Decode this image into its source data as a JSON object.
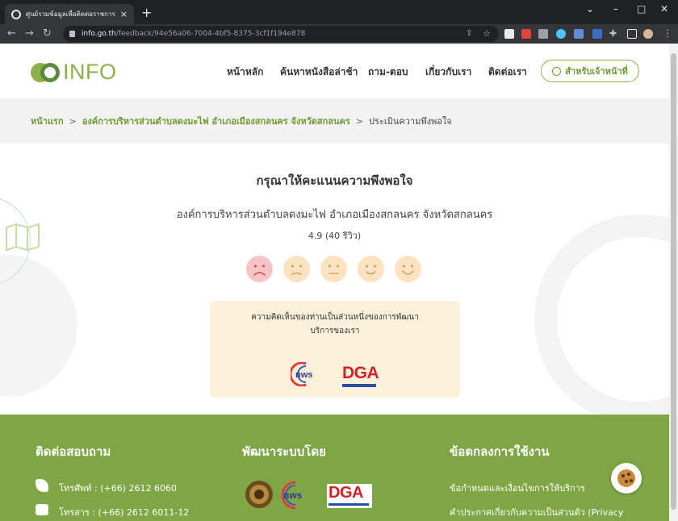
{
  "browser": {
    "tab_title": "ศูนย์รวมข้อมูลเพื่อติดต่อราชการ",
    "tab_close": "×",
    "new_tab": "+",
    "url_host": "info.go.th",
    "url_path": "/feedback/94e56a06-7004-4bf5-8375-3cf1f194e878"
  },
  "header": {
    "logo_text": "INFO",
    "nav": [
      "หน้าหลัก",
      "ค้นหาหนังสือล่าช้า",
      "ถาม-ตอบ",
      "เกี่ยวกับเรา",
      "ติดต่อเรา"
    ],
    "staff_button": "สำหรับเจ้าหน้าที่"
  },
  "breadcrumb": {
    "home": "หน้าแรก",
    "sep": ">",
    "org": "องค์การบริหารส่วนตำบลดงมะไฟ อำเภอเมืองสกลนคร จังหวัดสกลนคร",
    "current": "ประเมินความพึงพอใจ"
  },
  "main": {
    "title": "กรุณาให้คะแนนความพึงพอใจ",
    "org_name": "องค์การบริหารส่วนตำบลดงมะไฟ อำเภอเมืองสกลนคร จังหวัดสกลนคร",
    "rating": "4.9 (40 รีวิว)",
    "faces": [
      {
        "name": "very-dissatisfied",
        "color": "#f5c5c5",
        "stroke": "#d9534f"
      },
      {
        "name": "dissatisfied",
        "color": "#fbe3c2",
        "stroke": "#c9a66b"
      },
      {
        "name": "neutral",
        "color": "#fbe3c2",
        "stroke": "#c9a66b"
      },
      {
        "name": "satisfied",
        "color": "#fbe3c2",
        "stroke": "#c9a66b"
      },
      {
        "name": "very-satisfied",
        "color": "#fbe3c2",
        "stroke": "#c9a66b"
      }
    ],
    "card_line1": "ความคิดเห็นของท่านเป็นส่วนหนึ่งของการพัฒนา",
    "card_line2": "บริการของเรา",
    "logo_nws": "nws",
    "logo_dga": "DGA"
  },
  "footer": {
    "contact_heading": "ติดต่อสอบถาม",
    "phone": "โทรศัพท์ : (+66) 2612 6060",
    "fax": "โทรสาร : (+66) 2612 6011-12",
    "developed_heading": "พัฒนาระบบโดย",
    "terms_heading": "ข้อตกลงการใช้งาน",
    "terms_link": "ข้อกำหนดและเงื่อนไขการให้บริการ",
    "privacy_link": "คำประกาศเกี่ยวกับความเป็นส่วนตัว (Privacy"
  },
  "colors": {
    "brand_green": "#8db04a",
    "footer_green": "#7fa644",
    "card_bg": "#fdf1dc"
  }
}
